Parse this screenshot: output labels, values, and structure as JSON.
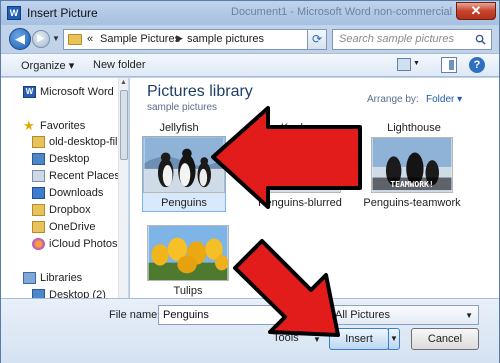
{
  "window": {
    "title": "Insert Picture",
    "background_title": "Document1 - Microsoft Word non-commercial"
  },
  "nav": {
    "breadcrumb_prefix": "«",
    "crumbs": [
      "Sample Pictures",
      "sample pictures"
    ],
    "search_placeholder": "Search sample pictures"
  },
  "toolbar": {
    "organize_label": "Organize ▾",
    "new_folder_label": "New folder"
  },
  "sidebar": {
    "items": [
      {
        "label": "Microsoft Word",
        "icon": "word-icon"
      },
      {
        "label": "Favorites",
        "icon": "star-icon"
      },
      {
        "label": "old-desktop-file",
        "icon": "folder-icon"
      },
      {
        "label": "Desktop",
        "icon": "desktop-icon"
      },
      {
        "label": "Recent Places",
        "icon": "recent-places-icon"
      },
      {
        "label": "Downloads",
        "icon": "downloads-icon"
      },
      {
        "label": "Dropbox",
        "icon": "dropbox-icon"
      },
      {
        "label": "OneDrive",
        "icon": "onedrive-icon"
      },
      {
        "label": "iCloud Photos",
        "icon": "icloud-icon"
      },
      {
        "label": "Libraries",
        "icon": "library-icon"
      },
      {
        "label": "Desktop (2)",
        "icon": "desktop-icon"
      }
    ]
  },
  "content": {
    "library_title": "Pictures library",
    "library_subtitle": "sample pictures",
    "arrange_label": "Arrange by:",
    "arrange_value": "Folder ▾",
    "previous_row": [
      "Jellyfish",
      "Koala",
      "Lighthouse"
    ],
    "files": [
      {
        "name": "Penguins",
        "selected": true
      },
      {
        "name": "Penguins-blurred",
        "selected": false
      },
      {
        "name": "Penguins-teamwork",
        "selected": false
      },
      {
        "name": "Tulips",
        "selected": false
      }
    ],
    "teamwork_caption": "TEAMWORK!"
  },
  "bottom": {
    "file_name_label": "File name:",
    "file_name_value": "Penguins",
    "filter_value": "All Pictures",
    "tools_label": "Tools",
    "insert_label": "Insert",
    "cancel_label": "Cancel"
  },
  "colors": {
    "arrow_red": "#e21b1b",
    "accent_blue": "#1f5ba9"
  }
}
